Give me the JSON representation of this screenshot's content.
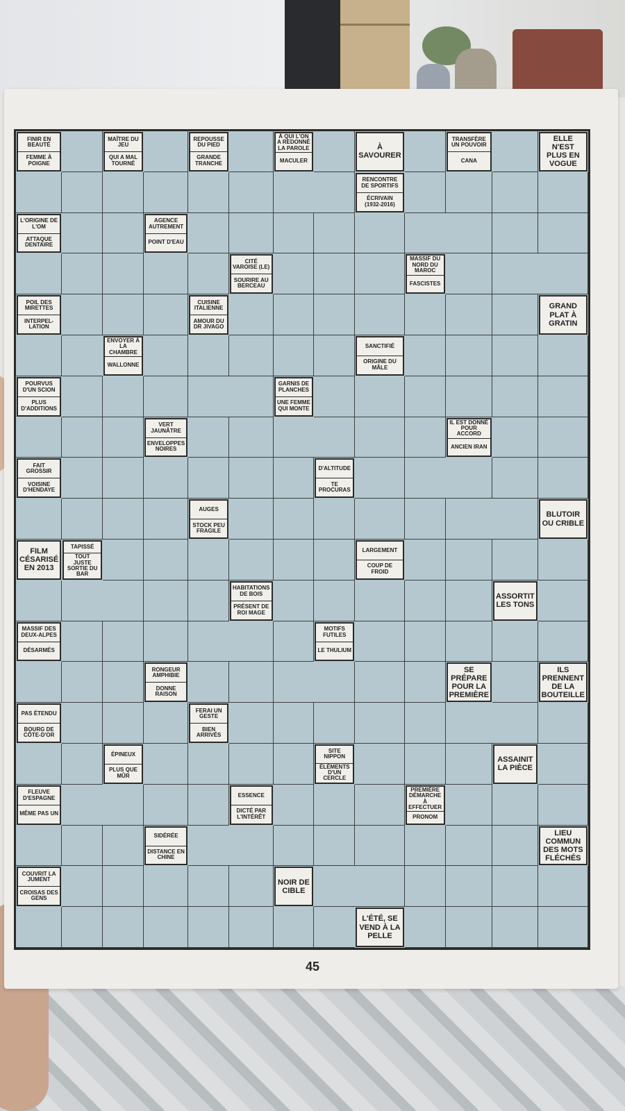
{
  "page_number": "45",
  "clues": [
    {
      "row": 1,
      "col": 1,
      "parts": [
        "FINIR EN BEAUTÉ",
        "FEMME À POIGNE"
      ]
    },
    {
      "row": 1,
      "col": 3,
      "parts": [
        "MAÎTRE DU JEU",
        "QUI A MAL TOURNÉ"
      ]
    },
    {
      "row": 1,
      "col": 5,
      "parts": [
        "REPOUSSE DU PIED",
        "GRANDE TRANCHE"
      ]
    },
    {
      "row": 1,
      "col": 7,
      "parts": [
        "À QUI L'ON A REDONNÉ LA PAROLE",
        "MACULER"
      ]
    },
    {
      "row": 1,
      "col": 9,
      "parts": [
        "À SAVOURER"
      ],
      "big": true
    },
    {
      "row": 1,
      "col": 11,
      "parts": [
        "TRANSFÈRE UN POUVOIR",
        "CANA"
      ]
    },
    {
      "row": 1,
      "col": 13,
      "parts": [
        "ELLE N'EST PLUS EN VOGUE"
      ],
      "big": true
    },
    {
      "row": 2,
      "col": 9,
      "parts": [
        "RENCONTRE DE SPORTIFS",
        "ÉCRIVAIN (1932-2016)"
      ]
    },
    {
      "row": 3,
      "col": 1,
      "parts": [
        "L'ORIGINE DE L'OM",
        "ATTAQUE DENTAIRE"
      ]
    },
    {
      "row": 3,
      "col": 4,
      "parts": [
        "AGENCE AUTREMENT",
        "POINT D'EAU"
      ]
    },
    {
      "row": 4,
      "col": 6,
      "parts": [
        "CITÉ VAROISE (LE)",
        "SOURIRE AU BERCEAU"
      ]
    },
    {
      "row": 4,
      "col": 10,
      "parts": [
        "MASSIF DU NORD DU MAROC",
        "FASCISTES"
      ]
    },
    {
      "row": 5,
      "col": 1,
      "parts": [
        "POIL DES MIRETTES",
        "INTERPEL-LATION"
      ]
    },
    {
      "row": 5,
      "col": 5,
      "parts": [
        "CUISINE ITALIENNE",
        "AMOUR DU DR JIVAGO"
      ]
    },
    {
      "row": 5,
      "col": 13,
      "parts": [
        "GRAND PLAT À GRATIN"
      ],
      "big": true
    },
    {
      "row": 6,
      "col": 3,
      "parts": [
        "ENVOYER À LA CHAMBRE",
        "WALLONNE"
      ]
    },
    {
      "row": 6,
      "col": 9,
      "parts": [
        "SANCTIFIÉ",
        "ORIGINE DU MÂLE"
      ]
    },
    {
      "row": 7,
      "col": 1,
      "parts": [
        "POURVUS D'UN SCION",
        "PLUS D'ADDITIONS"
      ]
    },
    {
      "row": 7,
      "col": 7,
      "parts": [
        "GARNIS DE PLANCHES",
        "UNE FEMME QUI MONTE"
      ]
    },
    {
      "row": 8,
      "col": 4,
      "parts": [
        "VERT JAUNÂTRE",
        "ENVELOPPES NOIRES"
      ]
    },
    {
      "row": 8,
      "col": 11,
      "parts": [
        "IL EST DONNÉ POUR ACCORD",
        "ANCIEN IRAN"
      ]
    },
    {
      "row": 9,
      "col": 1,
      "parts": [
        "FAIT GROSSIR",
        "VOISINE D'HENDAYE"
      ]
    },
    {
      "row": 9,
      "col": 8,
      "parts": [
        "D'ALTITUDE",
        "TE PROCURAS"
      ]
    },
    {
      "row": 10,
      "col": 5,
      "parts": [
        "AUGES",
        "STOCK PEU FRAGILE"
      ]
    },
    {
      "row": 10,
      "col": 13,
      "parts": [
        "BLUTOIR OU CRIBLE"
      ],
      "big": true
    },
    {
      "row": 11,
      "col": 1,
      "parts": [
        "FILM CÉSARISÉ EN 2013"
      ],
      "big": true
    },
    {
      "row": 11,
      "col": 2,
      "parts": [
        "TAPISSÉ",
        "TOUT JUSTE SORTIE DU BAR"
      ]
    },
    {
      "row": 11,
      "col": 9,
      "parts": [
        "LARGEMENT",
        "COUP DE FROID"
      ]
    },
    {
      "row": 12,
      "col": 6,
      "parts": [
        "HABITATIONS DE BOIS",
        "PRÉSENT DE ROI MAGE"
      ]
    },
    {
      "row": 12,
      "col": 12,
      "parts": [
        "ASSORTIT LES TONS"
      ],
      "big": true
    },
    {
      "row": 13,
      "col": 1,
      "parts": [
        "MASSIF DES DEUX-ALPES",
        "DÉSARMÉS"
      ]
    },
    {
      "row": 13,
      "col": 8,
      "parts": [
        "MOTIFS FUTILES",
        "LE THULIUM"
      ]
    },
    {
      "row": 14,
      "col": 4,
      "parts": [
        "RONGEUR AMPHIBIE",
        "DONNE RAISON"
      ]
    },
    {
      "row": 14,
      "col": 11,
      "parts": [
        "SE PRÉPARE POUR LA PREMIÈRE"
      ],
      "big": true
    },
    {
      "row": 14,
      "col": 13,
      "parts": [
        "ILS PRENNENT DE LA BOUTEILLE"
      ],
      "big": true
    },
    {
      "row": 15,
      "col": 1,
      "parts": [
        "PAS ÉTENDU",
        "BOURG DE CÔTE-D'OR"
      ]
    },
    {
      "row": 15,
      "col": 5,
      "parts": [
        "FERAI UN GESTE",
        "BIEN ARRIVÉS"
      ]
    },
    {
      "row": 16,
      "col": 3,
      "parts": [
        "ÉPINEUX",
        "PLUS QUE MÛR"
      ]
    },
    {
      "row": 16,
      "col": 8,
      "parts": [
        "SITE NIPPON",
        "ÉLÉMENTS D'UN CERCLE"
      ]
    },
    {
      "row": 16,
      "col": 12,
      "parts": [
        "ASSAINIT LA PIÈCE"
      ],
      "big": true
    },
    {
      "row": 17,
      "col": 1,
      "parts": [
        "FLEUVE D'ESPAGNE",
        "MÊME PAS UN"
      ]
    },
    {
      "row": 17,
      "col": 6,
      "parts": [
        "ESSENCE",
        "DICTÉ PAR L'INTÉRÊT"
      ]
    },
    {
      "row": 17,
      "col": 10,
      "parts": [
        "PREMIÈRE DÉMARCHE À EFFECTUER",
        "PRONOM"
      ]
    },
    {
      "row": 18,
      "col": 4,
      "parts": [
        "SIDÉRÉE",
        "DISTANCE EN CHINE"
      ]
    },
    {
      "row": 18,
      "col": 13,
      "parts": [
        "LIEU COMMUN DES MOTS FLÉCHÉS"
      ],
      "big": true
    },
    {
      "row": 19,
      "col": 1,
      "parts": [
        "COUVRIT LA JUMENT",
        "CROISAS DES GENS"
      ]
    },
    {
      "row": 19,
      "col": 7,
      "parts": [
        "NOIR DE CIBLE"
      ],
      "big": true
    },
    {
      "row": 20,
      "col": 9,
      "parts": [
        "L'ÉTÉ, SE VEND À LA PELLE"
      ],
      "big": true
    }
  ]
}
